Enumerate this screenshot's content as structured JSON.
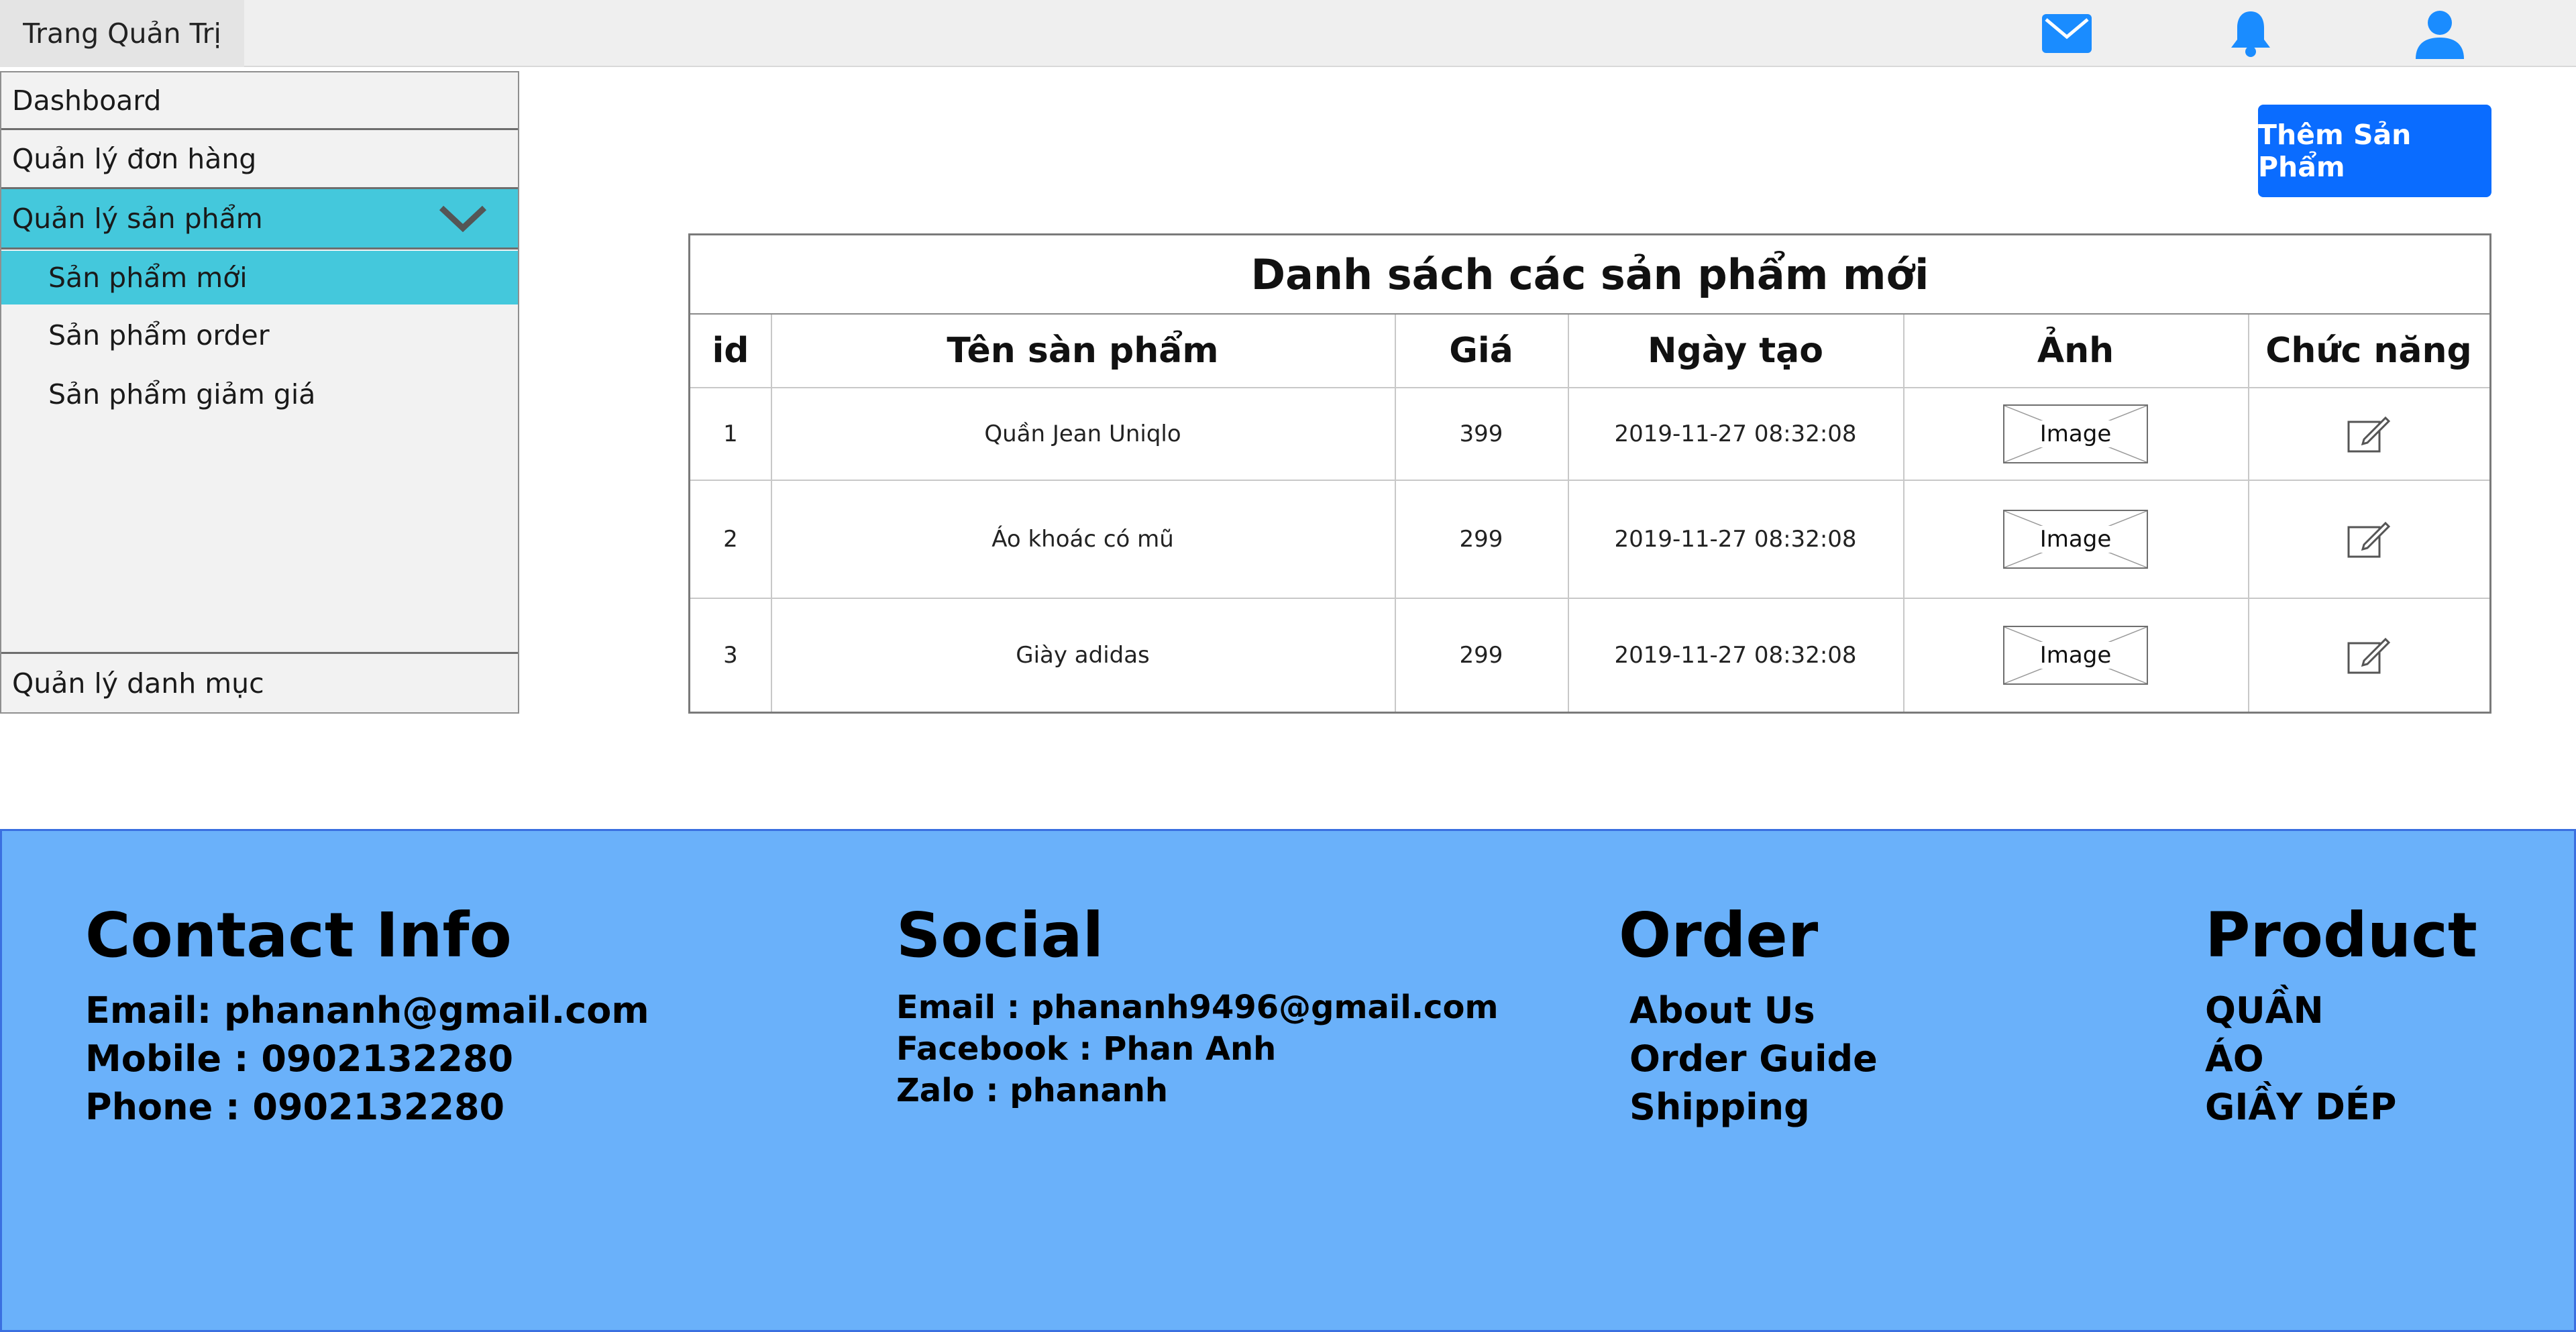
{
  "header": {
    "brand": "Trang Quản Trị",
    "icons": [
      "mail-icon",
      "bell-icon",
      "user-icon"
    ],
    "icon_color": "#1a8cff"
  },
  "sidebar": {
    "items": [
      {
        "label": "Dashboard"
      },
      {
        "label": "Quản lý đơn hàng"
      },
      {
        "label": "Quản lý sản phẩm",
        "expanded": true,
        "active": true
      },
      {
        "label": "Quản lý danh mục"
      }
    ],
    "sub_items": [
      {
        "label": "Sản phẩm mới",
        "active": true
      },
      {
        "label": "Sản phẩm order"
      },
      {
        "label": "Sản phẩm giảm giá"
      }
    ],
    "active_color": "#44c8dc"
  },
  "main": {
    "add_button": "Thêm Sản Phẩm",
    "table": {
      "title": "Danh sách các sản phẩm mới",
      "columns": [
        "id",
        "Tên sàn phẩm",
        "Giá",
        "Ngày tạo",
        "Ảnh",
        "Chức năng"
      ],
      "rows": [
        {
          "id": "1",
          "name": "Quần Jean Uniqlo",
          "price": "399",
          "date": "2019-11-27 08:32:08",
          "image": "Image"
        },
        {
          "id": "2",
          "name": "Áo khoác có mũ",
          "price": "299",
          "date": "2019-11-27 08:32:08",
          "image": "Image"
        },
        {
          "id": "3",
          "name": "Giày adidas",
          "price": "299",
          "date": "2019-11-27 08:32:08",
          "image": "Image"
        }
      ]
    }
  },
  "footer": {
    "background": "#6ab1fa",
    "contact": {
      "title": "Contact Info",
      "lines": [
        "Email: phananh@gmail.com",
        "Mobile : 0902132280",
        "Phone : 0902132280"
      ]
    },
    "social": {
      "title": "Social",
      "lines": [
        "Email : phananh9496@gmail.com",
        "Facebook : Phan Anh",
        "Zalo : phananh"
      ]
    },
    "order": {
      "title": "Order",
      "lines": [
        "About Us",
        "Order Guide",
        "Shipping"
      ]
    },
    "product": {
      "title": "Product",
      "lines": [
        "QUẦN",
        "ÁO",
        "GIẦY DÉP"
      ]
    }
  }
}
